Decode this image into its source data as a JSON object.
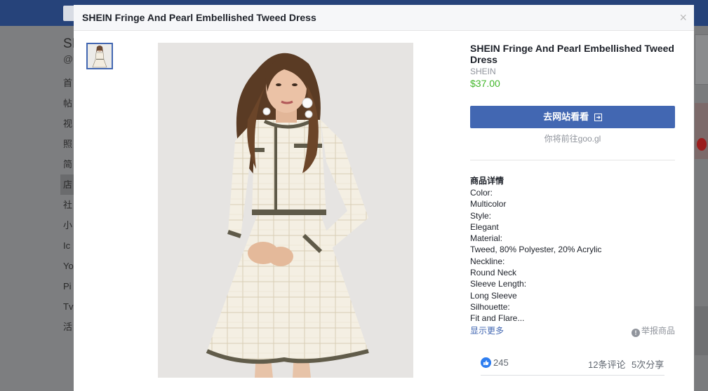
{
  "background": {
    "page_title_partial": "SI",
    "handle_partial": "@",
    "nav_items": [
      "首",
      "帖",
      "视",
      "照",
      "简",
      "店",
      "社",
      "小",
      "Ic",
      "Yo",
      "Pi",
      "Tv",
      "活"
    ],
    "active_nav_index": 5
  },
  "modal": {
    "title": "SHEIN Fringe And Pearl Embellished Tweed Dress",
    "close_symbol": "×"
  },
  "product": {
    "name": "SHEIN Fringe And Pearl Embellished Tweed Dress",
    "brand": "SHEIN",
    "price": "$37.00",
    "visit_button": "去网站看看",
    "redirect_note": "你将前往goo.gl",
    "details_heading": "商品详情",
    "details": [
      "Color:",
      "Multicolor",
      "Style:",
      "Elegant",
      "Material:",
      "Tweed, 80% Polyester, 20% Acrylic",
      "Neckline:",
      "Round Neck",
      "Sleeve Length:",
      "Long Sleeve",
      "Silhouette:",
      "Fit and Flare..."
    ],
    "show_more": "显示更多",
    "report": "举报商品"
  },
  "engagement": {
    "likes": "245",
    "comments": "12条评论",
    "shares": "5次分享"
  },
  "colors": {
    "facebook_blue": "#4267b2",
    "price_green": "#42b72a",
    "header_bar": "#26437a"
  }
}
